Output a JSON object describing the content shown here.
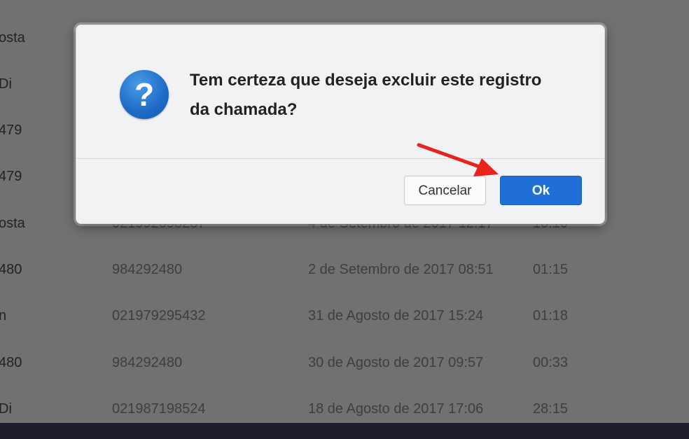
{
  "calls": [
    {
      "name": "osta",
      "number": "",
      "date": "",
      "duration": ""
    },
    {
      "name": "Di",
      "number": "",
      "date": "",
      "duration": ""
    },
    {
      "name": "479",
      "number": "",
      "date": "",
      "duration": ""
    },
    {
      "name": "479",
      "number": "",
      "date": "",
      "duration": ""
    },
    {
      "name": "osta",
      "number": "021992098287",
      "date": "4 de Setembro de 2017 12:17",
      "duration": "10:10"
    },
    {
      "name": "480",
      "number": "984292480",
      "date": "2 de Setembro de 2017 08:51",
      "duration": "01:15"
    },
    {
      "name": "n",
      "number": "021979295432",
      "date": "31 de Agosto de 2017 15:24",
      "duration": "01:18"
    },
    {
      "name": "480",
      "number": "984292480",
      "date": "30 de Agosto de 2017 09:57",
      "duration": "00:33"
    },
    {
      "name": "Di",
      "number": "021987198524",
      "date": "18 de Agosto de 2017 17:06",
      "duration": "28:15"
    }
  ],
  "dialog": {
    "icon": "question-icon",
    "icon_glyph": "?",
    "message": "Tem certeza que deseja excluir este registro da chamada?",
    "cancel_label": "Cancelar",
    "ok_label": "Ok"
  },
  "colors": {
    "ok_button": "#1f6fd6",
    "annotation_arrow": "#e8231b",
    "question_icon": "#1d6bc7"
  }
}
